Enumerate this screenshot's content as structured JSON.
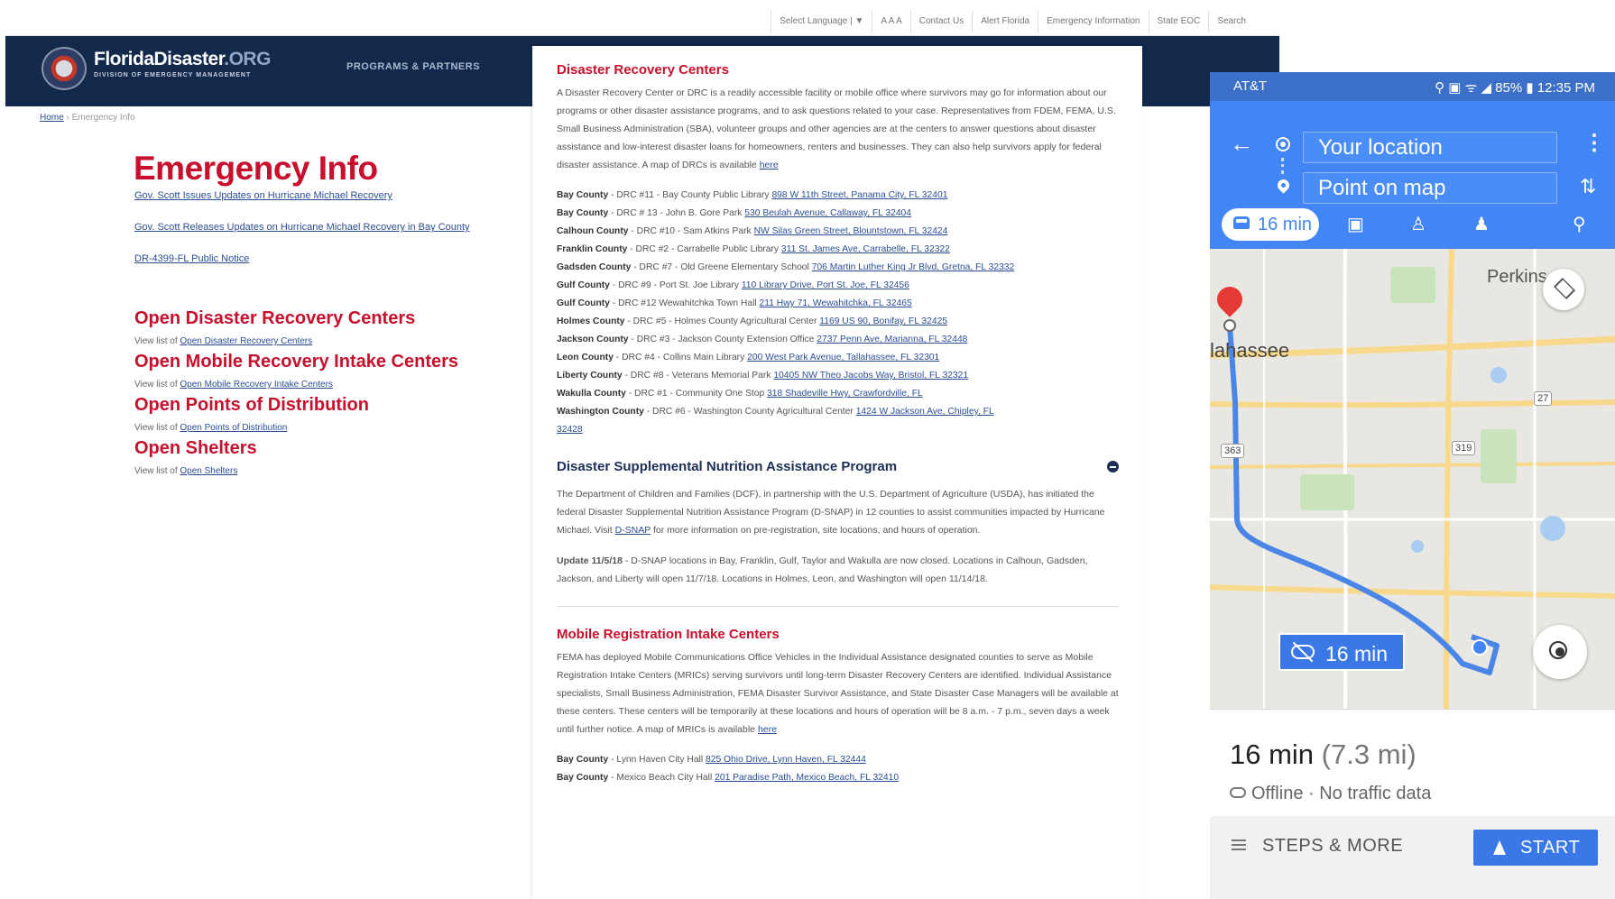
{
  "site": {
    "util_items": [
      "Select Language | ▼",
      "A A A",
      "Contact Us",
      "Alert Florida",
      "Emergency Information",
      "State EOC",
      "Search"
    ],
    "brand_name": "FloridaDisaster",
    "brand_suffix": ".ORG",
    "brand_sub": "DIVISION OF EMERGENCY MANAGEMENT",
    "nav_programs": "PROGRAMS & PARTNERS",
    "breadcrumb_home": "Home",
    "breadcrumb_current": "Emergency Info",
    "page_title": "Emergency Info",
    "update_links": [
      "Gov. Scott Issues Updates on Hurricane Michael Recovery",
      "Gov. Scott Releases Updates on Hurricane Michael Recovery in Bay County",
      "DR-4399-FL Public Notice"
    ],
    "sections": [
      {
        "heading": "Open Disaster Recovery Centers",
        "sub_prefix": "View list of ",
        "sub_link": "Open Disaster Recovery Centers"
      },
      {
        "heading": "Open Mobile Recovery Intake Centers",
        "sub_prefix": "View list of ",
        "sub_link": "Open Mobile Recovery Intake Centers"
      },
      {
        "heading": "Open Points of Distribution",
        "sub_prefix": "View list of ",
        "sub_link": "Open Points of Distribution"
      },
      {
        "heading": "Open Shelters",
        "sub_prefix": "View list of ",
        "sub_link": "Open Shelters"
      }
    ]
  },
  "article": {
    "drc_title": "Disaster Recovery Centers",
    "drc_intro": "A Disaster Recovery Center or DRC is a readily accessible facility or mobile office where survivors may go for information about our programs or other disaster assistance programs, and to ask questions related to your case. Representatives from FDEM, FEMA, U.S. Small Business Administration (SBA), volunteer groups and other agencies are at the centers to answer questions about disaster assistance and low-interest disaster loans for homeowners, renters and businesses. They can also help survivors apply for federal disaster assistance. A map of DRCs is available ",
    "drc_intro_link": "here",
    "drc_rows": [
      {
        "county": "Bay County",
        "detail": " - DRC #11 - Bay County Public Library ",
        "addr": "898 W 11th Street, Panama City, FL 32401"
      },
      {
        "county": "Bay County",
        "detail": " - DRC # 13 - John B. Gore Park ",
        "addr": "530 Beulah Avenue, Callaway, FL 32404"
      },
      {
        "county": "Calhoun County",
        "detail": " - DRC #10 - Sam Atkins Park ",
        "addr": "NW Silas Green Street, Blountstown, FL 32424"
      },
      {
        "county": "Franklin County",
        "detail": " - DRC #2 - Carrabelle Public Library ",
        "addr": "311 St. James Ave, Carrabelle, FL 32322"
      },
      {
        "county": "Gadsden County",
        "detail": " - DRC #7 - Old Greene Elementary School ",
        "addr": "706 Martin Luther King Jr Blvd, Gretna, FL 32332"
      },
      {
        "county": "Gulf County",
        "detail": " - DRC #9 - Port St. Joe Library ",
        "addr": "110 Library Drive, Port St. Joe, FL 32456"
      },
      {
        "county": "Gulf County",
        "detail": " - DRC #12 Wewahitchka Town Hall ",
        "addr": "211 Hwy 71, Wewahitchka, FL 32465"
      },
      {
        "county": "Holmes County",
        "detail": " - DRC #5 - Holmes County Agricultural Center ",
        "addr": "1169 US 90, Bonifay, FL 32425"
      },
      {
        "county": "Jackson County",
        "detail": " - DRC #3 - Jackson County Extension Office ",
        "addr": "2737 Penn Ave, Marianna, FL 32448"
      },
      {
        "county": "Leon County",
        "detail": " - DRC #4 - Collins Main Library ",
        "addr": "200 West Park Avenue, Tallahassee, FL 32301"
      },
      {
        "county": "Liberty County",
        "detail": " - DRC #8 - Veterans Memorial Park ",
        "addr": "10405 NW Theo Jacobs Way, Bristol, FL 32321"
      },
      {
        "county": "Wakulla County",
        "detail": " - DRC #1 - Community One Stop ",
        "addr": "318 Shadeville Hwy, Crawfordville, FL"
      },
      {
        "county": "Washington County",
        "detail": " - DRC #6 - Washington County Agricultural Center ",
        "addr": "1424 W Jackson Ave, Chipley, FL"
      }
    ],
    "drc_tail": "32428",
    "snap_title": "Disaster Supplemental Nutrition Assistance Program",
    "snap_intro": "The Department of Children and Families (DCF), in partnership with the U.S. Department of Agriculture (USDA), has initiated the federal Disaster Supplemental Nutrition Assistance Program (D-SNAP) in 12 counties to assist communities impacted by Hurricane Michael. Visit ",
    "snap_link": "D-SNAP",
    "snap_intro_tail": " for more information on pre-registration, site locations, and hours of operation.",
    "snap_update_label": "Update 11/5/18",
    "snap_update_text": " - D-SNAP locations in Bay, Franklin, Gulf, Taylor and Wakulla are now closed. Locations in Calhoun, Gadsden, Jackson, and Liberty will open 11/7/18. Locations in Holmes, Leon, and Washington will open 11/14/18.",
    "mric_title": "Mobile Registration Intake Centers",
    "mric_intro": "FEMA has deployed Mobile Communications Office Vehicles in the Individual Assistance designated counties to serve as Mobile Registration Intake Centers (MRICs) serving survivors until long-term Disaster Recovery Centers are identified. Individual Assistance specialists, Small Business Administration, FEMA Disaster Survivor Assistance, and State Disaster Case Managers will be available at these centers. These centers will be temporarily at these locations and hours of operation will be 8 a.m. - 7 p.m., seven days a week until further notice. A map of MRICs is available ",
    "mric_intro_link": "here",
    "mric_rows": [
      {
        "county": "Bay County",
        "detail": " - Lynn Haven City Hall ",
        "addr": "825 Ohio Drive, Lynn Haven, FL 32444"
      },
      {
        "county": "Bay County",
        "detail": " - Mexico Beach City Hall ",
        "addr": "201 Paradise Path, Mexico Beach, FL 32410"
      }
    ]
  },
  "phone": {
    "carrier": "AT&T",
    "status_right": "⚲ ▣ ᯤ ◢ 85% ▮ 12:35 PM",
    "origin": "Your location",
    "destination": "Point on map",
    "drive_time": "16 min",
    "map_labels": {
      "perkins": "Perkins",
      "city": "lahassee"
    },
    "route_shields": [
      "27",
      "363",
      "319"
    ],
    "bubble_time": "16 min",
    "sheet_time": "16 min",
    "sheet_distance": "(7.3 mi)",
    "sheet_status": "Offline · No traffic data",
    "steps_label": "STEPS & MORE",
    "start_label": "START",
    "colors": {
      "header_blue": "#4285f4",
      "status_blue": "#3b6fc8",
      "route_blue": "#4a86e8",
      "pin_red": "#e53935"
    }
  }
}
